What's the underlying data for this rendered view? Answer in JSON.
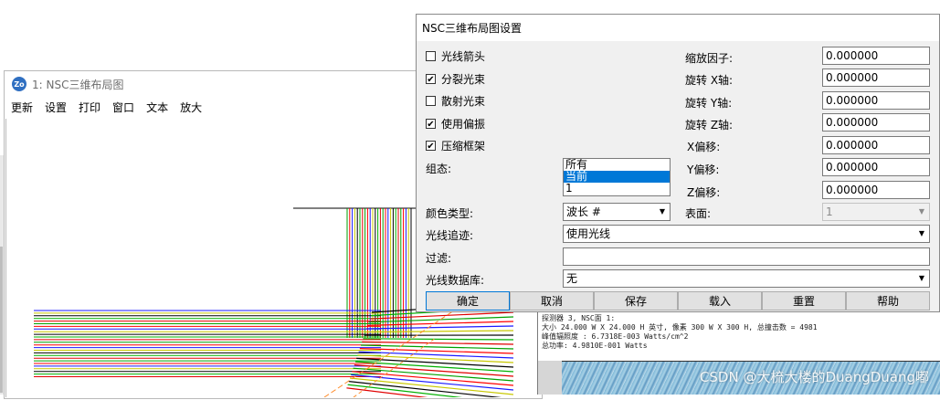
{
  "layout_window": {
    "title": "1: NSC三维布局图",
    "icon_text": "Zo",
    "menu": [
      "更新",
      "设置",
      "打印",
      "窗口",
      "文本",
      "放大"
    ]
  },
  "detector_window": {
    "info_lines": [
      "探测器 3, NSC面 1:",
      "大小 24.000 W X 24.000 H 英寸, 像素 300 W X 300 H, 总撞击数 = 4981",
      "峰值辐照度 : 6.7318E-003 Watts/cm^2",
      "总功率: 4.9810E-001 Watts"
    ]
  },
  "watermark": "CSDN @大梳大楼的DuangDuang嘟",
  "dialog": {
    "title": "NSC三维布局图设置",
    "checkboxes": [
      {
        "label": "光线箭头",
        "checked": false
      },
      {
        "label": "分裂光束",
        "checked": true
      },
      {
        "label": "散射光束",
        "checked": false
      },
      {
        "label": "使用偏振",
        "checked": true
      },
      {
        "label": "压缩框架",
        "checked": true
      }
    ],
    "config": {
      "label": "组态:",
      "options": [
        "所有",
        "当前",
        "1"
      ],
      "selected_index": 1
    },
    "color_type": {
      "label": "颜色类型:",
      "value": "波长 #"
    },
    "surface": {
      "label": "表面:",
      "value": "1"
    },
    "ray_trace": {
      "label": "光线追迹:",
      "value": "使用光线"
    },
    "filter": {
      "label": "过滤:",
      "value": ""
    },
    "ray_database": {
      "label": "光线数据库:",
      "value": "无"
    },
    "fields": [
      {
        "label": "缩放因子:",
        "value": "0.000000"
      },
      {
        "label": "旋转 X轴:",
        "value": "0.000000"
      },
      {
        "label": "旋转 Y轴:",
        "value": "0.000000"
      },
      {
        "label": "旋转 Z轴:",
        "value": "0.000000"
      },
      {
        "label": "X偏移:",
        "value": "0.000000"
      },
      {
        "label": "Y偏移:",
        "value": "0.000000"
      },
      {
        "label": "Z偏移:",
        "value": "0.000000"
      }
    ],
    "buttons": [
      "确定",
      "取消",
      "保存",
      "载入",
      "重置",
      "帮助"
    ]
  }
}
